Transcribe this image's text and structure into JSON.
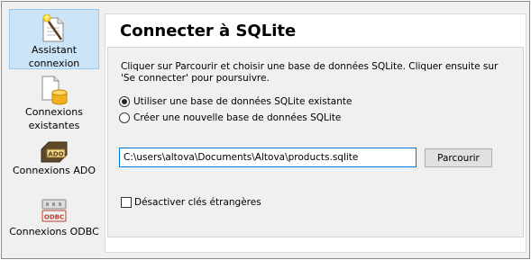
{
  "sidebar": {
    "items": [
      {
        "label": "Assistant connexion",
        "icon": "wizard-icon",
        "active": true
      },
      {
        "label": "Connexions existantes",
        "icon": "existing-connections-icon",
        "active": false
      },
      {
        "label": "Connexions ADO",
        "icon": "ado-icon",
        "active": false
      },
      {
        "label": "Connexions ODBC",
        "icon": "odbc-icon",
        "active": false
      }
    ]
  },
  "main": {
    "title": "Connecter à SQLite",
    "description": "Cliquer sur Parcourir et choisir une base de données SQLite. Cliquer ensuite sur 'Se connecter' pour poursuivre.",
    "radio_existing": "Utiliser une base de données SQLite existante",
    "radio_new": "Créer une nouvelle base de données SQLite",
    "path_value": "C:\\users\\altova\\Documents\\Altova\\products.sqlite",
    "browse_label": "Parcourir",
    "checkbox_label": "Désactiver clés étrangères",
    "selected_option": "existing",
    "checkbox_checked": false
  },
  "colors": {
    "active_bg": "#cce4f7",
    "input_focus_border": "#0078d7"
  }
}
